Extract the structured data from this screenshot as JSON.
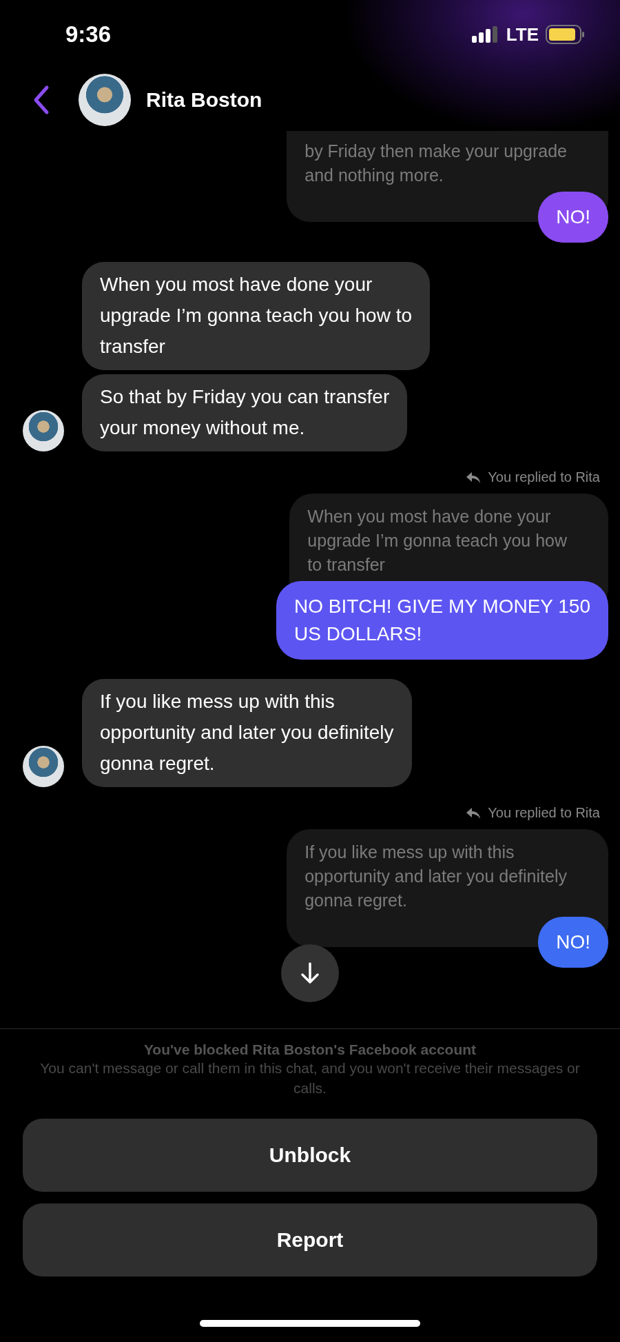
{
  "status_bar": {
    "time": "9:36",
    "network": "LTE"
  },
  "header": {
    "name": "Rita Boston"
  },
  "messages": [
    {
      "kind": "reply",
      "quote": "by Friday then make your upgrade\nand nothing more.",
      "text": "NO!",
      "color": "#8a4cf0"
    },
    {
      "kind": "incoming",
      "lines": [
        "When you most have done your\nupgrade I’m gonna teach you how to\ntransfer",
        "So that by Friday you can transfer\nyour money without me."
      ]
    },
    {
      "kind": "reply",
      "label": "You replied to Rita",
      "quote": "When you most have done your\nupgrade I’m gonna teach you how\nto transfer",
      "text": "NO BITCH! GIVE MY MONEY 150\nUS DOLLARS!",
      "color": "#5d55f2"
    },
    {
      "kind": "incoming",
      "lines": [
        "If you like mess up with this\nopportunity and later you definitely\ngonna regret."
      ]
    },
    {
      "kind": "reply",
      "label": "You replied to Rita",
      "quote": "If you like mess up with this\nopportunity and later you definitely\ngonna regret.",
      "text": "NO!",
      "color": "#3e6cf2"
    }
  ],
  "blocked": {
    "title": "You've blocked Rita Boston's Facebook account",
    "body": "You can't message or call them in this chat, and you won't receive their messages or calls."
  },
  "buttons": [
    "Unblock",
    "Report"
  ]
}
